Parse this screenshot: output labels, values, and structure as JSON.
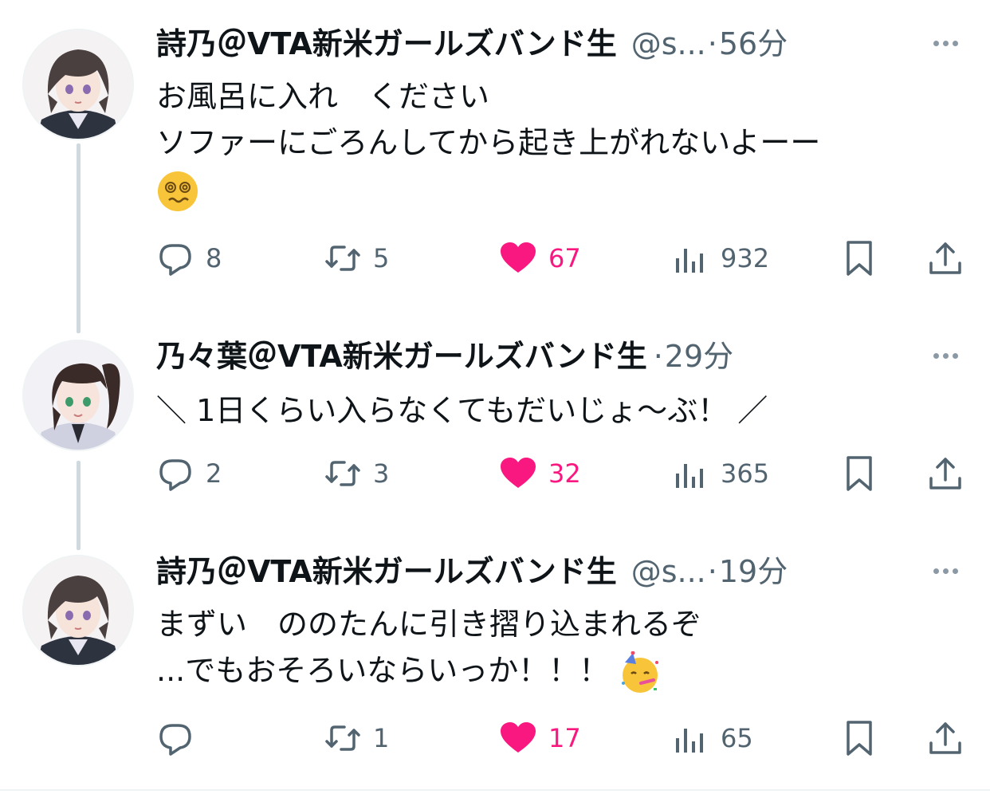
{
  "tweets": [
    {
      "author": "詩乃＠VTA新米ガールズバンド生",
      "handle": "@s...",
      "time": "56分",
      "lines": [
        "お風呂に入れ　ください",
        "ソファーにごろんしてから起き上がれないよーー"
      ],
      "emoji": "dizzy-face-emoji",
      "reply_count": "8",
      "retweet_count": "5",
      "like_count": "67",
      "view_count": "932"
    },
    {
      "author": "乃々葉＠VTA新米ガールズバンド生",
      "time": "29分",
      "lines": [
        "＼ 1日くらい入らなくてもだいじょ～ぶ！ ／"
      ],
      "reply_count": "2",
      "retweet_count": "3",
      "like_count": "32",
      "view_count": "365"
    },
    {
      "author": "詩乃＠VTA新米ガールズバンド生",
      "handle": "@s...",
      "time": "19分",
      "lines": [
        "まずい　ののたんに引き摺り込まれるぞ",
        "...でもおそろいならいっか！！！"
      ],
      "emoji": "partying-face-emoji",
      "reply_count": "",
      "retweet_count": "1",
      "like_count": "17",
      "view_count": "65"
    }
  ],
  "separator": "·",
  "colors": {
    "text": "#0f1419",
    "secondary": "#536471",
    "like": "#f91880",
    "thread_line": "#cfd9de"
  },
  "icons": [
    "reply-icon",
    "retweet-icon",
    "heart-icon",
    "views-icon",
    "bookmark-icon",
    "share-icon",
    "more-icon"
  ]
}
